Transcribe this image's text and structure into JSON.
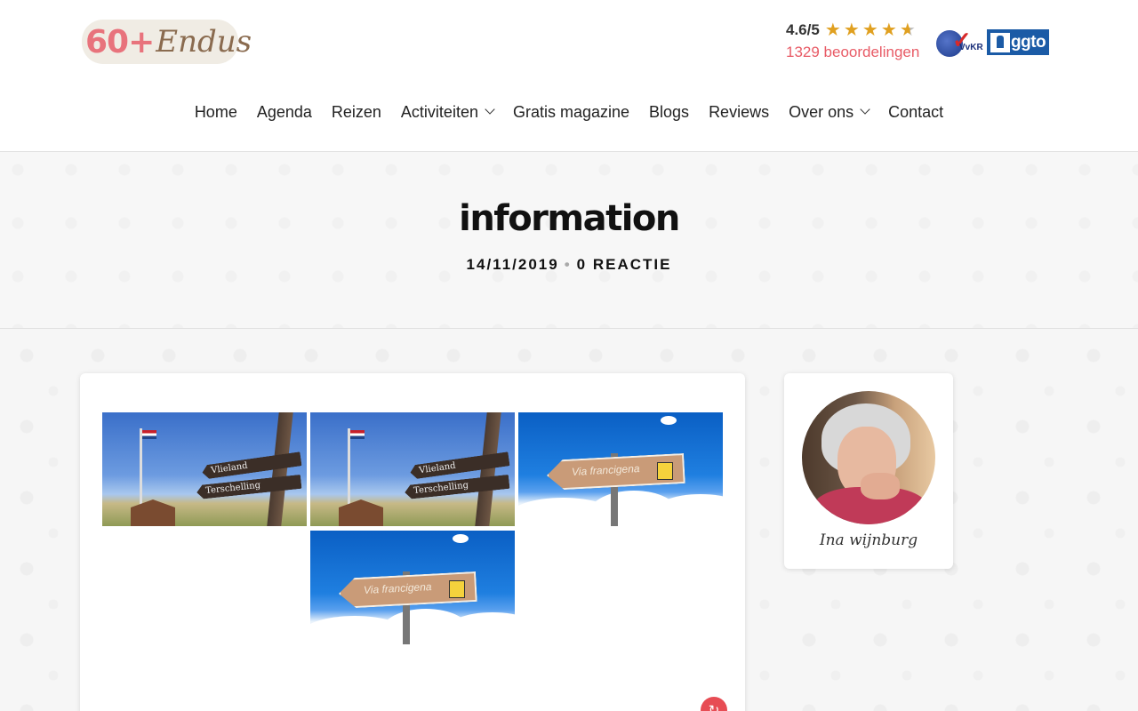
{
  "brand": {
    "logo_number": "60+",
    "logo_text": "Endus"
  },
  "rating": {
    "score": "4.6/5",
    "stars": 4.6,
    "reviews": "1329 beoordelingen",
    "star_color": "#e0a020",
    "reviews_color": "#e85b66"
  },
  "badges": {
    "vkr_text": "VvKR",
    "ggto_text": "ggto"
  },
  "nav": {
    "items": [
      {
        "label": "Home"
      },
      {
        "label": "Agenda"
      },
      {
        "label": "Reizen"
      },
      {
        "label": "Activiteiten",
        "dropdown": true
      },
      {
        "label": "Gratis magazine"
      },
      {
        "label": "Blogs"
      },
      {
        "label": "Reviews"
      },
      {
        "label": "Over ons",
        "dropdown": true
      },
      {
        "label": "Contact"
      }
    ]
  },
  "post": {
    "title": "information",
    "date": "14/11/2019",
    "separator": "•",
    "comments": "0 REACTIE"
  },
  "gallery": {
    "items": [
      {
        "type": "signpost",
        "sign1": "Vlieland",
        "sign2": "Terschelling"
      },
      {
        "type": "signpost",
        "sign1": "Vlieland",
        "sign2": "Terschelling"
      },
      {
        "type": "via",
        "sign": "Via francigena"
      },
      {
        "type": "via",
        "sign": "Via francigena"
      }
    ]
  },
  "author": {
    "name": "Ina wijnburg"
  },
  "share": {
    "icon": "share-icon",
    "color": "#e74c54"
  }
}
